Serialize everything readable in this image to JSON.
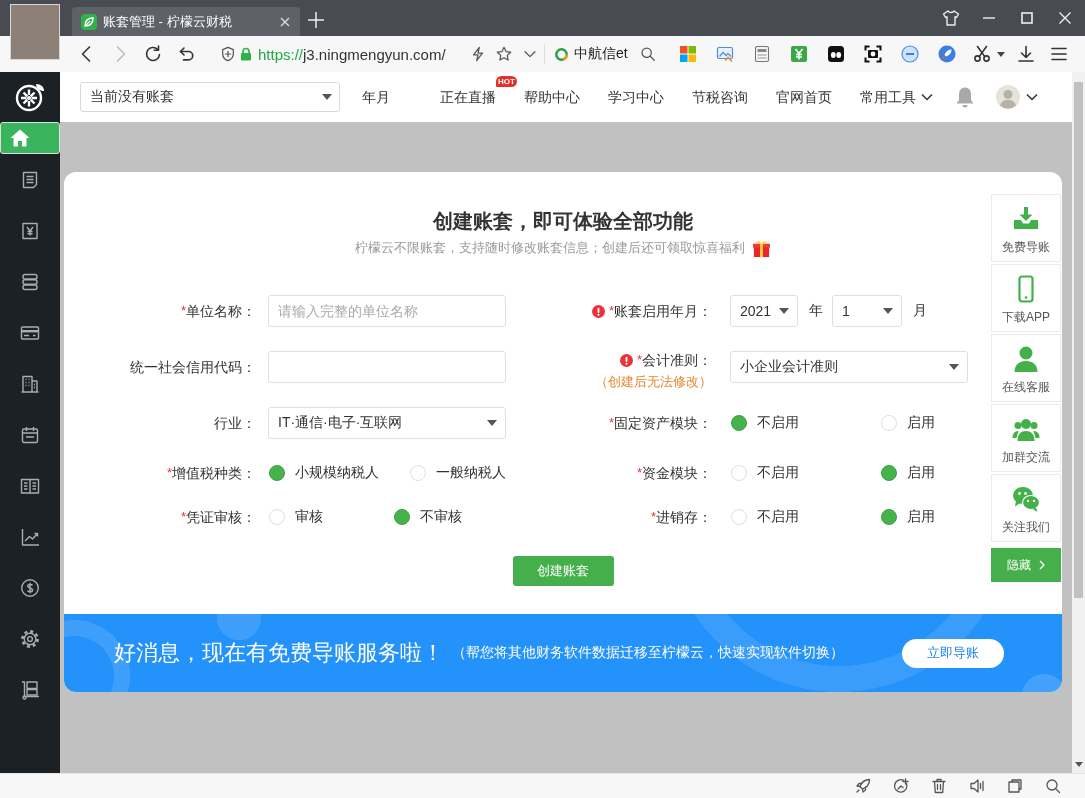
{
  "browser": {
    "tab": {
      "title": "账套管理 - 柠檬云财税"
    },
    "history": {
      "back_disabled": false,
      "forward_disabled": true
    },
    "address": {
      "scheme": "https://",
      "host": "j3.ningmengyun.com/"
    },
    "search_engine": {
      "name": "中航信et"
    }
  },
  "app_nav": {
    "account_select": {
      "value": "当前没有账套"
    },
    "items": [
      {
        "label": "年月",
        "dropdown": false
      },
      {
        "label": "正在直播",
        "badge": "HOT",
        "dropdown": false
      },
      {
        "label": "帮助中心",
        "dropdown": false
      },
      {
        "label": "学习中心",
        "dropdown": false
      },
      {
        "label": "节税咨询",
        "dropdown": false
      },
      {
        "label": "官网首页",
        "dropdown": false
      },
      {
        "label": "常用工具",
        "dropdown": true
      }
    ]
  },
  "sidebar": {
    "items": [
      {
        "selected": true
      },
      {
        "selected": false
      },
      {
        "selected": false
      },
      {
        "selected": false
      },
      {
        "selected": false
      },
      {
        "selected": false
      },
      {
        "selected": false
      },
      {
        "selected": false
      },
      {
        "selected": false
      },
      {
        "selected": false
      },
      {
        "selected": false
      },
      {
        "selected": false
      }
    ]
  },
  "form": {
    "title": "创建账套，即可体验全部功能",
    "subtitle": "柠檬云不限账套，支持随时修改账套信息；创建后还可领取惊喜福利",
    "left_fields": [
      {
        "kind": "text",
        "warning": false,
        "required_mark": "*",
        "label": "单位名称：",
        "placeholder": "请输入完整的单位名称"
      },
      {
        "kind": "text",
        "warning": false,
        "label": "统一社会信用代码："
      },
      {
        "kind": "select",
        "warning": false,
        "label": "行业：",
        "value": "IT·通信·电子·互联网"
      },
      {
        "kind": "radio",
        "warning": false,
        "required_mark": "*",
        "label": "增值税种类：",
        "options": [
          {
            "label": "小规模纳税人",
            "selected": true
          },
          {
            "label": "一般纳税人",
            "selected": false
          }
        ]
      },
      {
        "kind": "radio",
        "warning": false,
        "required_mark": "*",
        "label": "凭证审核：",
        "options": [
          {
            "label": "审核",
            "selected": false
          },
          {
            "label": "不审核",
            "selected": true
          }
        ]
      }
    ],
    "right_fields": [
      {
        "kind": "year_month",
        "warning": true,
        "required_mark": "*",
        "label": "账套启用年月：",
        "year": "2021",
        "year_unit": "年",
        "month": "1",
        "month_unit": "月"
      },
      {
        "kind": "select",
        "warning": true,
        "required_mark": "*",
        "label": "会计准则：",
        "note": "（创建后无法修改）",
        "value": "小企业会计准则"
      },
      {
        "kind": "radio",
        "warning": false,
        "required_mark": "*",
        "label": "固定资产模块：",
        "options": [
          {
            "label": "不启用",
            "selected": true
          },
          {
            "label": "启用",
            "selected": false
          }
        ]
      },
      {
        "kind": "radio",
        "warning": false,
        "required_mark": "*",
        "label": "资金模块：",
        "options": [
          {
            "label": "不启用",
            "selected": false
          },
          {
            "label": "启用",
            "selected": true
          }
        ]
      },
      {
        "kind": "radio",
        "warning": false,
        "required_mark": "*",
        "label": "进销存：",
        "options": [
          {
            "label": "不启用",
            "selected": false
          },
          {
            "label": "启用",
            "selected": true
          }
        ]
      }
    ],
    "submit": "创建账套"
  },
  "side_toolbar": {
    "items": [
      {
        "label": "免费导账"
      },
      {
        "label": "下载APP"
      },
      {
        "label": "在线客服"
      },
      {
        "label": "加群交流"
      },
      {
        "label": "关注我们"
      }
    ],
    "hide_button": "隐藏"
  },
  "banner": {
    "title": "好消息，现在有免费导账服务啦！",
    "subtitle": "（帮您将其他财务软件数据迁移至柠檬云，快速实现软件切换）",
    "button": "立即导账"
  }
}
